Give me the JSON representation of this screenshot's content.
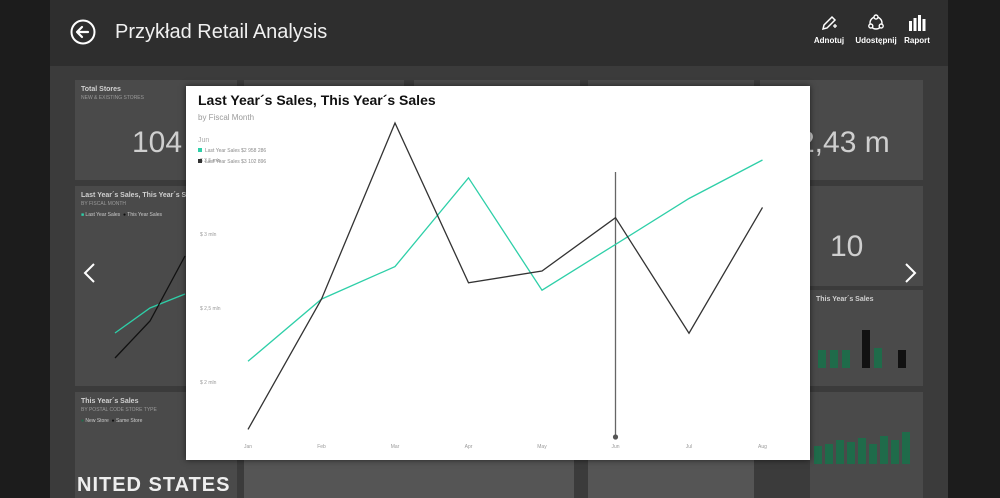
{
  "header": {
    "title": "Przykład Retail Analysis",
    "buttons": {
      "annotate": "Adnotuj",
      "share": "Udostępnij",
      "report": "Raport"
    }
  },
  "background_tiles": {
    "total_stores": {
      "title": "Total Stores",
      "subtitle": "NEW & EXISTING STORES",
      "value": "104"
    },
    "sales_tile_title": "Last Year´s Sales, This Year´s Sales",
    "sales_tile_subtitle": "BY FISCAL MONTH",
    "sales_tile_legend": [
      "Last Year Sales",
      "This Year Sales"
    ],
    "this_year_tile_title": "This Year´s Sales",
    "this_year_tile_subtitle": "BY POSTAL CODE STORE TYPE",
    "this_year_tile_legend": [
      "New Store",
      "Same Store"
    ],
    "right_value_1": "2,43 m",
    "right_value_2": "10",
    "map_text": "NITED STATES"
  },
  "colors": {
    "last_year": "#2ecfa8",
    "this_year": "#333333",
    "green_bar": "#1f6b4a"
  },
  "chart_data": {
    "type": "line",
    "title": "Last Year´s Sales, This Year´s Sales",
    "subtitle": "by Fiscal Month",
    "tooltip_category": "Jun",
    "legend": [
      {
        "name": "Last Year Sales",
        "label": "Last Year Sales $2 958 286"
      },
      {
        "name": "This Year Sales",
        "label": "Last Year Sales $3 102 896"
      }
    ],
    "categories": [
      "Jan",
      "Feb",
      "Mar",
      "Apr",
      "May",
      "Jun",
      "Jul",
      "Aug"
    ],
    "series": [
      {
        "name": "Last Year Sales",
        "values": [
          2.14,
          2.56,
          2.78,
          3.38,
          2.62,
          2.93,
          3.24,
          3.5
        ]
      },
      {
        "name": "This Year Sales",
        "values": [
          1.68,
          2.56,
          3.75,
          2.67,
          2.75,
          3.11,
          2.33,
          3.18
        ]
      }
    ],
    "yticks": [
      {
        "value": 2,
        "label": "$ 2 mln"
      },
      {
        "value": 2.5,
        "label": "$ 2,5 mln"
      },
      {
        "value": 3,
        "label": "$ 3 mln"
      },
      {
        "value": 3.5,
        "label": "$ 3,5 mln"
      }
    ],
    "ylim": [
      1.5,
      4.0
    ],
    "highlight_index": 5,
    "grid": false,
    "legend_position": "top-left"
  }
}
